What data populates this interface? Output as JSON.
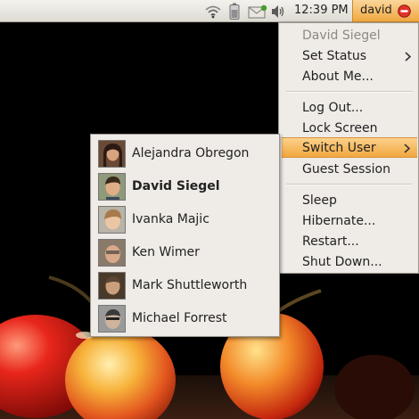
{
  "panel": {
    "clock": "12:39 PM",
    "user_button_label": "david",
    "icons": [
      "wifi-icon",
      "battery-icon",
      "mail-icon",
      "volume-icon",
      "power-icon"
    ],
    "accent": "#f0a841"
  },
  "user_menu": {
    "items": [
      {
        "label": "David Siegel",
        "enabled": false
      },
      {
        "label": "Set Status",
        "submenu": true
      },
      {
        "label": "About Me..."
      },
      {
        "label": "Log Out..."
      },
      {
        "label": "Lock Screen"
      },
      {
        "label": "Switch User",
        "submenu": true,
        "highlighted": true
      },
      {
        "label": "Guest Session"
      },
      {
        "label": "Sleep"
      },
      {
        "label": "Hibernate..."
      },
      {
        "label": "Restart..."
      },
      {
        "label": "Shut Down..."
      }
    ]
  },
  "switch_user_menu": {
    "users": [
      {
        "name": "Alejandra Obregon",
        "current": false
      },
      {
        "name": "David Siegel",
        "current": true
      },
      {
        "name": "Ivanka Majic",
        "current": false
      },
      {
        "name": "Ken Wimer",
        "current": false
      },
      {
        "name": "Mark Shuttleworth",
        "current": false
      },
      {
        "name": "Michael Forrest",
        "current": false
      }
    ]
  },
  "colors": {
    "menu_bg": "#efebe7",
    "highlight": "#f2a73f",
    "disabled_text": "#8c8a85"
  }
}
